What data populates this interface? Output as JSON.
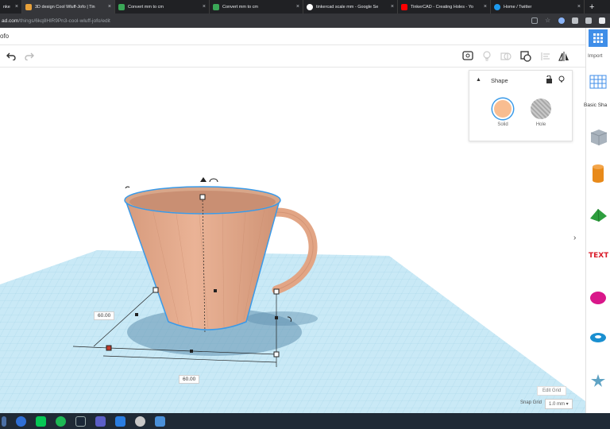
{
  "browser": {
    "tabs": [
      {
        "title": "nke",
        "favicon": "#4285f4"
      },
      {
        "title": "3D design Cool Wluff-Jofo | Tin",
        "favicon": "#e8a13a",
        "active": true
      },
      {
        "title": "Convert mm to cm",
        "favicon": "#3aa757"
      },
      {
        "title": "Convert mm to cm",
        "favicon": "#3aa757"
      },
      {
        "title": "tinkercad scale mm - Google Se",
        "favicon": "#ffffff"
      },
      {
        "title": "TinkerCAD - Creating Holes - Yo",
        "favicon": "#ff0000"
      },
      {
        "title": "Home / Twitter",
        "favicon": "#1d9bf0"
      }
    ],
    "url_host": "ad.com",
    "url_path": "/things/6kq8HlR9Pn3-cool-wluff-jofo/edit"
  },
  "app": {
    "name": "ofo"
  },
  "inspector": {
    "title": "Shape",
    "solid_label": "Solid",
    "hole_label": "Hole"
  },
  "sidebar": {
    "import_label": "Import",
    "basic_shapes_label": "Basic Sha"
  },
  "dimensions": {
    "depth": "60.00",
    "width": "60.00"
  },
  "grid": {
    "edit_grid_label": "Edit Grid",
    "snap_grid_label": "Snap Grid",
    "snap_value": "1.0 mm ▾"
  },
  "colors": {
    "accent": "#3f8ee8",
    "cup": "#e7a98a",
    "workplane": "#bfe4f3",
    "selection": "#3a9ae8"
  }
}
